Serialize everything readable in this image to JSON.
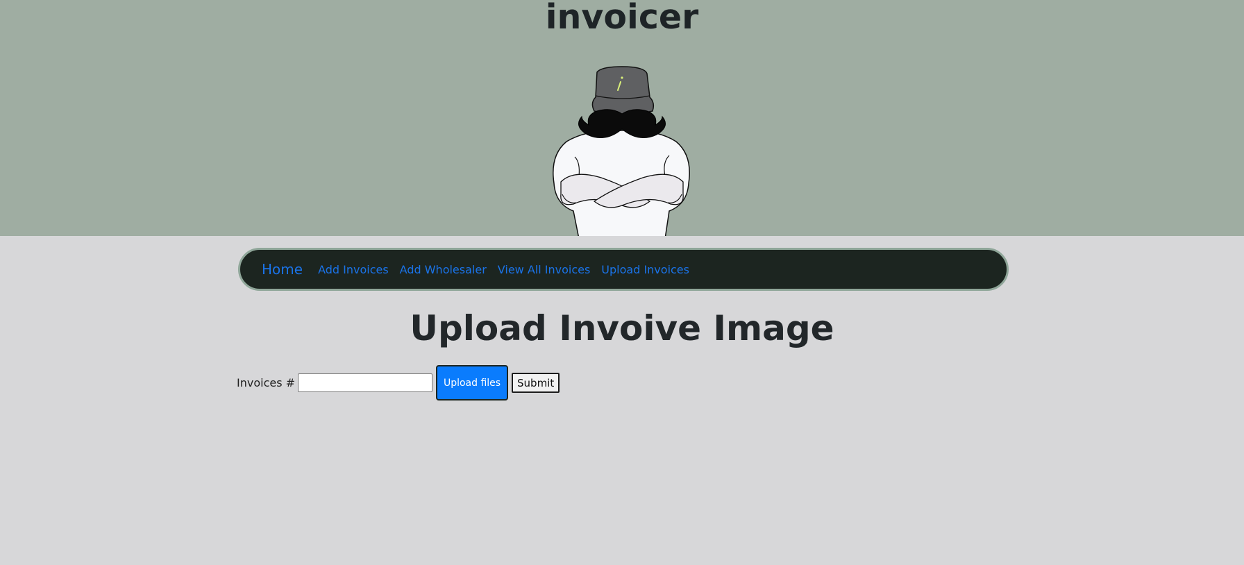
{
  "header": {
    "app_title": "invoicer"
  },
  "nav": {
    "brand": "Home",
    "links": [
      "Add Invoices",
      "Add Wholesaler",
      "View All Invoices",
      "Upload Invoices"
    ]
  },
  "main": {
    "heading": "Upload Invoive Image",
    "form": {
      "label": "Invoices #",
      "input_value": "",
      "upload_label": "Upload files",
      "submit_label": "Submit"
    }
  },
  "colors": {
    "hero_bg": "#9fada2",
    "page_bg": "#d7d7d9",
    "navbar_bg": "#1c2520",
    "link": "#1a73e8",
    "primary_button": "#0a7cfd"
  }
}
